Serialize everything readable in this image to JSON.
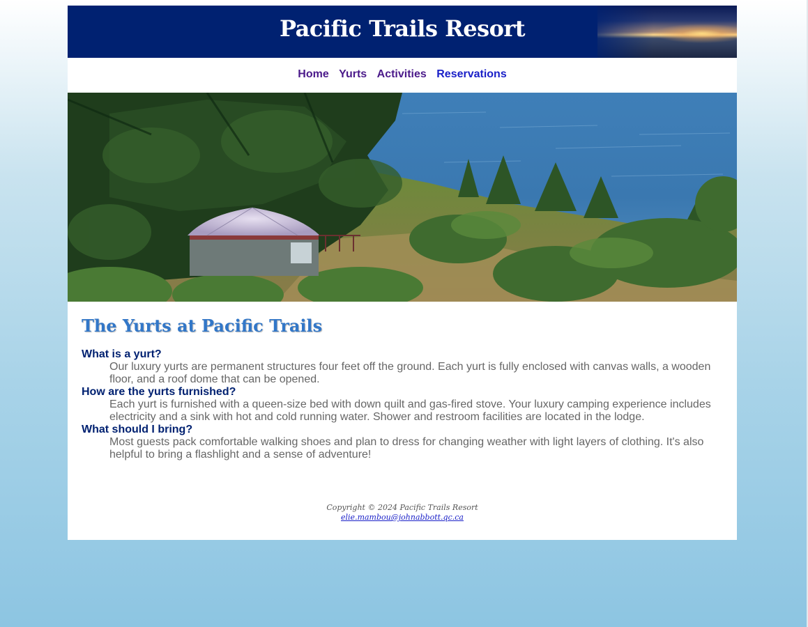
{
  "header": {
    "title": "Pacific Trails Resort"
  },
  "nav": {
    "items": [
      {
        "label": "Home"
      },
      {
        "label": "Yurts"
      },
      {
        "label": "Activities"
      },
      {
        "label": "Reservations"
      }
    ]
  },
  "hero": {
    "alt": "Yurt overlooking the Pacific Ocean"
  },
  "main": {
    "heading": "The Yurts at Pacific Trails",
    "faq": [
      {
        "question": "What is a yurt?",
        "answer": "Our luxury yurts are permanent structures four feet off the ground. Each yurt is fully enclosed with canvas walls, a wooden floor, and a roof dome that can be opened."
      },
      {
        "question": "How are the yurts furnished?",
        "answer": "Each yurt is furnished with a queen-size bed with down quilt and gas-fired stove. Your luxury camping experience includes electricity and a sink with hot and cold running water. Shower and restroom facilities are located in the lodge."
      },
      {
        "question": "What should I bring?",
        "answer": "Most guests pack comfortable walking shoes and plan to dress for changing weather with light layers of clothing. It's also helpful to bring a flashlight and a sense of adventure!"
      }
    ]
  },
  "footer": {
    "copyright": "Copyright © 2024 Pacific Trails Resort",
    "email": "elie.mambou@johnabbott.qc.ca"
  },
  "colors": {
    "header_bg": "#002171",
    "heading": "#3277c8",
    "question": "#002171",
    "answer": "#666666",
    "nav_visited": "#4b1a8a",
    "nav_link": "#1a20c8"
  }
}
